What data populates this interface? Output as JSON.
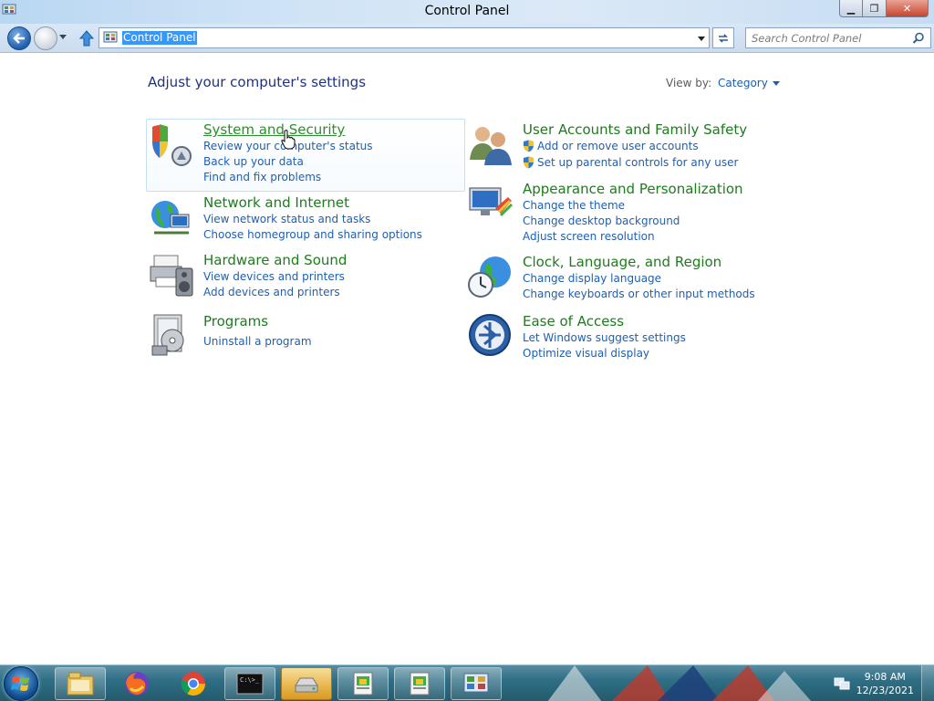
{
  "window": {
    "title": "Control Panel"
  },
  "navbar": {
    "address_value": "Control Panel",
    "search_placeholder": "Search Control Panel"
  },
  "content": {
    "heading": "Adjust your computer's settings",
    "view_by_label": "View by:",
    "view_by_value": "Category",
    "categories": [
      {
        "title": "System and Security",
        "icon": "shield-icon",
        "links": [
          "Review your computer's status",
          "Back up your data",
          "Find and fix problems"
        ]
      },
      {
        "title": "Network and Internet",
        "icon": "network-globe-icon",
        "links": [
          "View network status and tasks",
          "Choose homegroup and sharing options"
        ]
      },
      {
        "title": "Hardware and Sound",
        "icon": "printer-speaker-icon",
        "links": [
          "View devices and printers",
          "Add devices and printers"
        ]
      },
      {
        "title": "Programs",
        "icon": "programs-icon",
        "links": [
          "Uninstall a program"
        ]
      },
      {
        "title": "User Accounts and Family Safety",
        "icon": "users-icon",
        "links": [
          "Add or remove user accounts",
          "Set up parental controls for any user"
        ]
      },
      {
        "title": "Appearance and Personalization",
        "icon": "monitor-paint-icon",
        "links": [
          "Change the theme",
          "Change desktop background",
          "Adjust screen resolution"
        ]
      },
      {
        "title": "Clock, Language, and Region",
        "icon": "clock-globe-icon",
        "links": [
          "Change display language",
          "Change keyboards or other input methods"
        ]
      },
      {
        "title": "Ease of Access",
        "icon": "ease-of-access-icon",
        "links": [
          "Let Windows suggest settings",
          "Optimize visual display"
        ]
      }
    ]
  },
  "taskbar": {
    "clock_time": "9:08 AM",
    "clock_date": "12/23/2021",
    "items": [
      "start-orb-icon",
      "explorer-icon",
      "firefox-icon",
      "chrome-icon",
      "cmd-icon",
      "drive-icon",
      "app-icon",
      "app-icon",
      "control-panel-icon"
    ]
  },
  "colors": {
    "category_title": "#1e7b1e",
    "link": "#1f5fb0",
    "heading": "#1e3287"
  }
}
